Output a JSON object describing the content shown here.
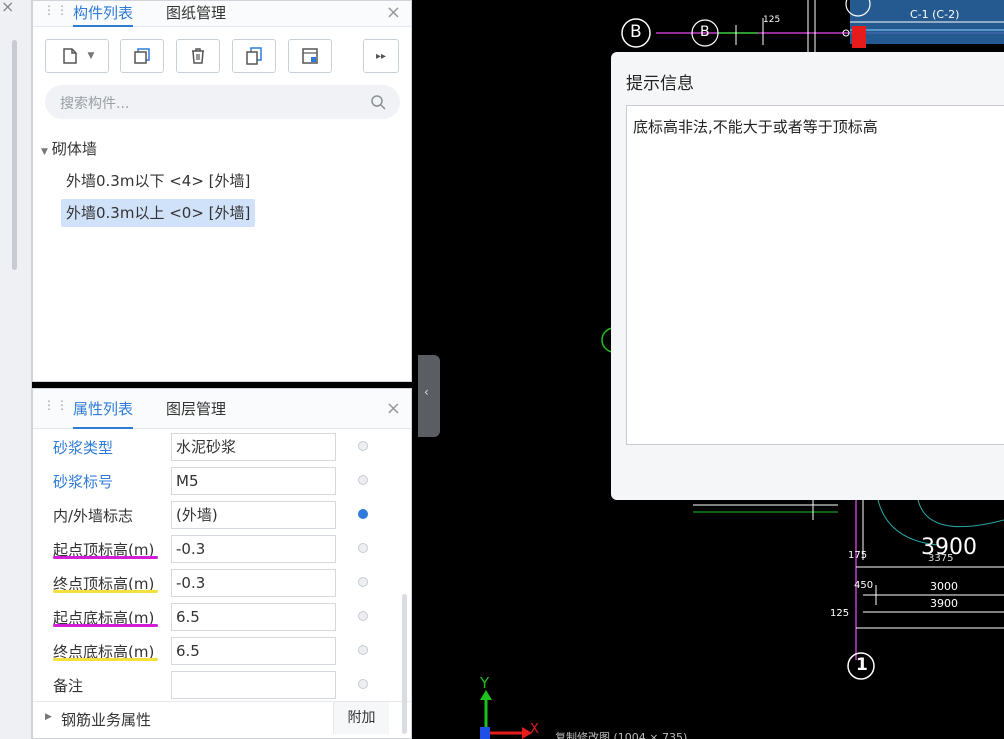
{
  "component_panel": {
    "tabs": [
      "构件列表",
      "图纸管理"
    ],
    "search_placeholder": "搜索构件...",
    "tree": {
      "group": "砌体墙",
      "items": [
        "外墙0.3m以下 <4> [外墙]",
        "外墙0.3m以上 <0> [外墙]"
      ],
      "selected_index": 1
    },
    "toolbar_icons": [
      "new-icon",
      "dropdown-icon",
      "copy-icon",
      "delete-icon",
      "copy-to-icon",
      "import-icon",
      "more-icon"
    ]
  },
  "property_panel": {
    "tabs": [
      "属性列表",
      "图层管理"
    ],
    "rows": [
      {
        "label": "砂浆类型",
        "value": "水泥砂浆",
        "blue": true,
        "dot": false
      },
      {
        "label": "砂浆标号",
        "value": "M5",
        "blue": true,
        "dot": false
      },
      {
        "label": "内/外墙标志",
        "value": "(外墙)",
        "blue": false,
        "dot": true
      },
      {
        "label": "起点顶标高(m)",
        "value": "-0.3",
        "blue": false,
        "dot": false,
        "underline": "pink"
      },
      {
        "label": "终点顶标高(m)",
        "value": "-0.3",
        "blue": false,
        "dot": false,
        "underline": "yellow"
      },
      {
        "label": "起点底标高(m)",
        "value": "6.5",
        "blue": false,
        "dot": false,
        "underline": "pink"
      },
      {
        "label": "终点底标高(m)",
        "value": "6.5",
        "blue": false,
        "dot": false,
        "underline": "yellow"
      },
      {
        "label": "备注",
        "value": "",
        "blue": false,
        "dot": false
      }
    ],
    "group": {
      "label": "钢筋业务属性",
      "action": "附加"
    }
  },
  "dialog": {
    "title": "提示信息",
    "message": "底标高非法,不能大于或者等于顶标高"
  },
  "cad": {
    "labels": {
      "axis_b1": "B",
      "axis_b2": "B",
      "axis_1": "1",
      "window": "C-1 (C-2)",
      "dim_big": "3900",
      "dim_3375": "3375",
      "dim_3000": "3000",
      "dim_3900": "3900",
      "dim_175": "175",
      "dim_450": "450",
      "dim_125": "125",
      "dim_125b": "125",
      "y_axis": "Y",
      "x_axis": "X"
    },
    "status": "复制修改图 (1004 × 735)"
  }
}
